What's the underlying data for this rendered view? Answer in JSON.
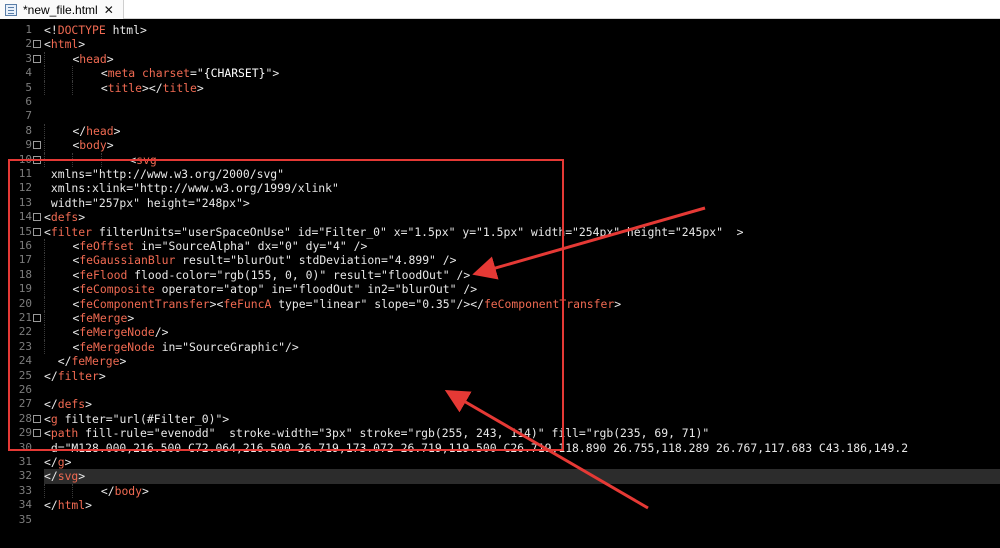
{
  "tab": {
    "title": "*new_file.html",
    "close_glyph": "✕",
    "icon": "html-file-icon"
  },
  "lines": [
    {
      "n": "1",
      "fold": false,
      "indent": 0,
      "tokens": [
        [
          "t",
          "<!"
        ],
        [
          "tag",
          "DOCTYPE"
        ],
        [
          "t",
          " html>"
        ]
      ]
    },
    {
      "n": "2",
      "fold": true,
      "indent": 0,
      "tokens": [
        [
          "t",
          "<"
        ],
        [
          "tag",
          "html"
        ],
        [
          "t",
          ">"
        ]
      ]
    },
    {
      "n": "3",
      "fold": true,
      "indent": 1,
      "tokens": [
        [
          "t",
          "<"
        ],
        [
          "tag",
          "head"
        ],
        [
          "t",
          ">"
        ]
      ]
    },
    {
      "n": "4",
      "fold": false,
      "indent": 2,
      "tokens": [
        [
          "t",
          "<"
        ],
        [
          "tag",
          "meta"
        ],
        [
          "t",
          " "
        ],
        [
          "tag",
          "charset"
        ],
        [
          "t",
          "=\""
        ],
        [
          "str",
          "{CHARSET}"
        ],
        [
          "t",
          "\">"
        ]
      ]
    },
    {
      "n": "5",
      "fold": false,
      "indent": 2,
      "tokens": [
        [
          "t",
          "<"
        ],
        [
          "tag",
          "title"
        ],
        [
          "t",
          "></"
        ],
        [
          "tag",
          "title"
        ],
        [
          "t",
          ">"
        ]
      ]
    },
    {
      "n": "6",
      "fold": false,
      "indent": 0,
      "tokens": []
    },
    {
      "n": "7",
      "fold": false,
      "indent": 0,
      "tokens": []
    },
    {
      "n": "8",
      "fold": false,
      "indent": 1,
      "tokens": [
        [
          "t",
          "</"
        ],
        [
          "tag",
          "head"
        ],
        [
          "t",
          ">"
        ]
      ]
    },
    {
      "n": "9",
      "fold": true,
      "indent": 1,
      "tokens": [
        [
          "t",
          "<"
        ],
        [
          "tag",
          "body"
        ],
        [
          "t",
          ">"
        ]
      ]
    },
    {
      "n": "10",
      "fold": true,
      "indent": 3,
      "tokens": [
        [
          "t",
          "<"
        ],
        [
          "tag",
          "svg"
        ]
      ]
    },
    {
      "n": "11",
      "fold": false,
      "indent": 0,
      "tokens": [
        [
          "t",
          " xmlns=\"http://www.w3.org/2000/svg\""
        ]
      ]
    },
    {
      "n": "12",
      "fold": false,
      "indent": 0,
      "tokens": [
        [
          "t",
          " xmlns:xlink=\"http://www.w3.org/1999/xlink\""
        ]
      ]
    },
    {
      "n": "13",
      "fold": false,
      "indent": 0,
      "tokens": [
        [
          "t",
          " width=\"257px\" height=\"248px\">"
        ]
      ]
    },
    {
      "n": "14",
      "fold": true,
      "indent": 0,
      "tokens": [
        [
          "t",
          "<"
        ],
        [
          "tag",
          "defs"
        ],
        [
          "t",
          ">"
        ]
      ]
    },
    {
      "n": "15",
      "fold": true,
      "indent": 0,
      "tokens": [
        [
          "t",
          "<"
        ],
        [
          "tag",
          "filter"
        ],
        [
          "t",
          " filterUnits=\"userSpaceOnUse\" id=\"Filter_0\" x=\"1.5px\" y=\"1.5px\" width=\"254px\" height=\"245px\"  >"
        ]
      ]
    },
    {
      "n": "16",
      "fold": false,
      "indent": 1,
      "tokens": [
        [
          "t",
          "<"
        ],
        [
          "tag",
          "feOffset"
        ],
        [
          "t",
          " in=\"SourceAlpha\" dx=\"0\" dy=\"4\" />"
        ]
      ]
    },
    {
      "n": "17",
      "fold": false,
      "indent": 1,
      "tokens": [
        [
          "t",
          "<"
        ],
        [
          "tag",
          "feGaussianBlur"
        ],
        [
          "t",
          " result=\"blurOut\" stdDeviation=\"4.899\" />"
        ]
      ]
    },
    {
      "n": "18",
      "fold": false,
      "indent": 1,
      "tokens": [
        [
          "t",
          "<"
        ],
        [
          "tag",
          "feFlood"
        ],
        [
          "t",
          " flood-color=\"rgb(155, 0, 0)\" result=\"floodOut\" />"
        ]
      ]
    },
    {
      "n": "19",
      "fold": false,
      "indent": 1,
      "tokens": [
        [
          "t",
          "<"
        ],
        [
          "tag",
          "feComposite"
        ],
        [
          "t",
          " operator=\"atop\" in=\"floodOut\" in2=\"blurOut\" />"
        ]
      ]
    },
    {
      "n": "20",
      "fold": false,
      "indent": 1,
      "tokens": [
        [
          "t",
          "<"
        ],
        [
          "tag",
          "feComponentTransfer"
        ],
        [
          "t",
          "><"
        ],
        [
          "tag",
          "feFuncA"
        ],
        [
          "t",
          " type=\"linear\" slope=\"0.35\"/></"
        ],
        [
          "tag",
          "feComponentTransfer"
        ],
        [
          "t",
          ">"
        ]
      ]
    },
    {
      "n": "21",
      "fold": true,
      "indent": 1,
      "tokens": [
        [
          "t",
          "<"
        ],
        [
          "tag",
          "feMerge"
        ],
        [
          "t",
          ">"
        ]
      ]
    },
    {
      "n": "22",
      "fold": false,
      "indent": 1,
      "tokens": [
        [
          "t",
          "<"
        ],
        [
          "tag",
          "feMergeNode"
        ],
        [
          "t",
          "/>"
        ]
      ]
    },
    {
      "n": "23",
      "fold": false,
      "indent": 1,
      "tokens": [
        [
          "t",
          "<"
        ],
        [
          "tag",
          "feMergeNode"
        ],
        [
          "t",
          " in=\"SourceGraphic\"/>"
        ]
      ]
    },
    {
      "n": "24",
      "fold": false,
      "indent": 0,
      "tokens": [
        [
          "t",
          "  </"
        ],
        [
          "tag",
          "feMerge"
        ],
        [
          "t",
          ">"
        ]
      ]
    },
    {
      "n": "25",
      "fold": false,
      "indent": 0,
      "tokens": [
        [
          "t",
          "</"
        ],
        [
          "tag",
          "filter"
        ],
        [
          "t",
          ">"
        ]
      ]
    },
    {
      "n": "26",
      "fold": false,
      "indent": 0,
      "tokens": []
    },
    {
      "n": "27",
      "fold": false,
      "indent": 0,
      "tokens": [
        [
          "t",
          "</"
        ],
        [
          "tag",
          "defs"
        ],
        [
          "t",
          ">"
        ]
      ]
    },
    {
      "n": "28",
      "fold": true,
      "indent": 0,
      "tokens": [
        [
          "t",
          "<"
        ],
        [
          "tag",
          "g"
        ],
        [
          "t",
          " filter=\"url(#Filter_0)\">"
        ]
      ]
    },
    {
      "n": "29",
      "fold": true,
      "indent": 0,
      "tokens": [
        [
          "t",
          "<"
        ],
        [
          "tag",
          "path"
        ],
        [
          "t",
          " fill-rule=\"evenodd\"  stroke-width=\"3px\" stroke=\"rgb(255, 243, 114)\" fill=\"rgb(235, 69, 71)\""
        ]
      ]
    },
    {
      "n": "30",
      "fold": false,
      "indent": 0,
      "tokens": [
        [
          "t",
          " d=\"M128.000,216.500 C72.064,216.500 26.719,173.072 26.719,119.500 C26.719,118.890 26.755,118.289 26.767,117.683 C43.186,149.2"
        ]
      ]
    },
    {
      "n": "31",
      "fold": false,
      "indent": 0,
      "tokens": [
        [
          "t",
          "</"
        ],
        [
          "tag",
          "g"
        ],
        [
          "t",
          ">"
        ]
      ]
    },
    {
      "n": "32",
      "fold": false,
      "indent": 0,
      "tokens": [
        [
          "t",
          "</"
        ],
        [
          "tag",
          "svg"
        ],
        [
          "t",
          ">"
        ]
      ]
    },
    {
      "n": "33",
      "fold": false,
      "indent": 2,
      "tokens": [
        [
          "t",
          "</"
        ],
        [
          "tag",
          "body"
        ],
        [
          "t",
          ">"
        ]
      ]
    },
    {
      "n": "34",
      "fold": false,
      "indent": 0,
      "tokens": [
        [
          "t",
          "</"
        ],
        [
          "tag",
          "html"
        ],
        [
          "t",
          ">"
        ]
      ]
    },
    {
      "n": "35",
      "fold": false,
      "indent": 0,
      "tokens": []
    }
  ],
  "current_line": "32",
  "colors": {
    "tag": "#f06a52",
    "text": "#e8e8e8",
    "annotation": "#e53935",
    "background": "#000000"
  }
}
